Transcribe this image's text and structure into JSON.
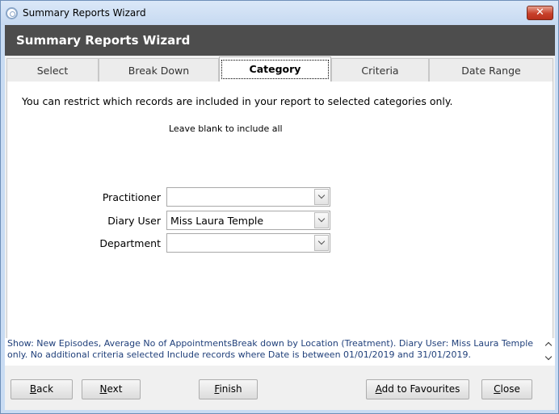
{
  "window": {
    "title": "Summary Reports Wizard",
    "close_glyph": "✕"
  },
  "header": {
    "title": "Summary Reports Wizard"
  },
  "tabs": [
    {
      "label": "Select",
      "active": false
    },
    {
      "label": "Break Down",
      "active": false
    },
    {
      "label": "Category",
      "active": true
    },
    {
      "label": "Criteria",
      "active": false
    },
    {
      "label": "Date Range",
      "active": false
    }
  ],
  "category": {
    "intro": "You can restrict which records are included in your report to selected categories only.",
    "hint": "Leave blank to include all",
    "fields": [
      {
        "label": "Practitioner",
        "value": ""
      },
      {
        "label": "Diary User",
        "value": "Miss Laura Temple"
      },
      {
        "label": "Department",
        "value": ""
      }
    ]
  },
  "summary": {
    "text": "Show: New Episodes, Average No of AppointmentsBreak down by Location (Treatment). Diary User: Miss Laura Temple only. No additional criteria selected Include records where Date is between 01/01/2019 and 31/01/2019."
  },
  "buttons": {
    "back": {
      "first": "B",
      "rest": "ack"
    },
    "next": {
      "first": "N",
      "rest": "ext"
    },
    "finish": {
      "first": "F",
      "rest": "inish"
    },
    "add_favourites": {
      "first": "A",
      "rest": "dd to Favourites"
    },
    "close": {
      "first": "C",
      "rest": "lose"
    }
  },
  "colors": {
    "header_band": "#4d4d4d",
    "summary_text": "#1f3f7a",
    "close_button": "#c8402a"
  }
}
